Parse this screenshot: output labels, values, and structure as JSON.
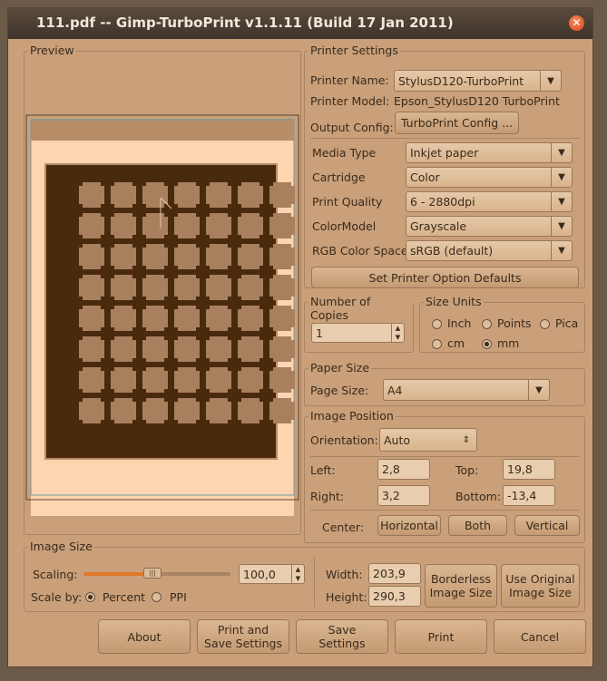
{
  "window": {
    "title": "111.pdf -- Gimp-TurboPrint v1.1.11 (Build 17 Jan 2011)",
    "close_glyph": "✕"
  },
  "preview": {
    "label": "Preview"
  },
  "printer_settings": {
    "label": "Printer Settings",
    "printer_name_label": "Printer Name:",
    "printer_name": "StylusD120-TurboPrint",
    "printer_model_label": "Printer Model:",
    "printer_model": "Epson_StylusD120 TurboPrint",
    "output_config_label": "Output Config:",
    "output_config_button": "TurboPrint Config ...",
    "options": [
      {
        "label": "Media Type",
        "value": "Inkjet paper"
      },
      {
        "label": "Cartridge",
        "value": "Color"
      },
      {
        "label": "Print Quality",
        "value": "6 - 2880dpi"
      },
      {
        "label": "ColorModel",
        "value": "Grayscale"
      },
      {
        "label": "RGB Color Space",
        "value": "sRGB (default)"
      }
    ],
    "defaults_button": "Set Printer Option Defaults"
  },
  "copies": {
    "label": "Number of Copies",
    "value": "1"
  },
  "size_units": {
    "label": "Size Units",
    "inch": "Inch",
    "points": "Points",
    "pica": "Pica",
    "cm": "cm",
    "mm": "mm",
    "selected": "mm"
  },
  "paper_size": {
    "label": "Paper Size",
    "page_size_label": "Page Size:",
    "page_size": "A4"
  },
  "image_position": {
    "label": "Image Position",
    "orientation_label": "Orientation:",
    "orientation": "Auto",
    "left_label": "Left:",
    "left": "2,8",
    "top_label": "Top:",
    "top": "19,8",
    "right_label": "Right:",
    "right": "3,2",
    "bottom_label": "Bottom:",
    "bottom": "-13,4",
    "center_label": "Center:",
    "horizontal_button": "Horizontal",
    "both_button": "Both",
    "vertical_button": "Vertical"
  },
  "image_size": {
    "label": "Image Size",
    "scaling_label": "Scaling:",
    "scaling": "100,0",
    "scaling_fraction": 0.47,
    "scale_by_label": "Scale by:",
    "percent": "Percent",
    "ppi": "PPI",
    "selected": "Percent",
    "width_label": "Width:",
    "width": "203,9",
    "height_label": "Height:",
    "height": "290,3",
    "borderless_button": "Borderless Image Size",
    "original_button": "Use Original Image Size"
  },
  "buttons": {
    "about": "About",
    "print_save": "Print and Save Settings",
    "save": "Save Settings",
    "print": "Print",
    "cancel": "Cancel"
  },
  "icons": {
    "combo_arrow": "chevron-down-icon",
    "spin": "spin-arrows-icon"
  },
  "colors": {
    "bg": "#c9a07a",
    "accent": "#e07a2a",
    "paper": "#fdd5b1",
    "image": "#4a2a0c"
  }
}
